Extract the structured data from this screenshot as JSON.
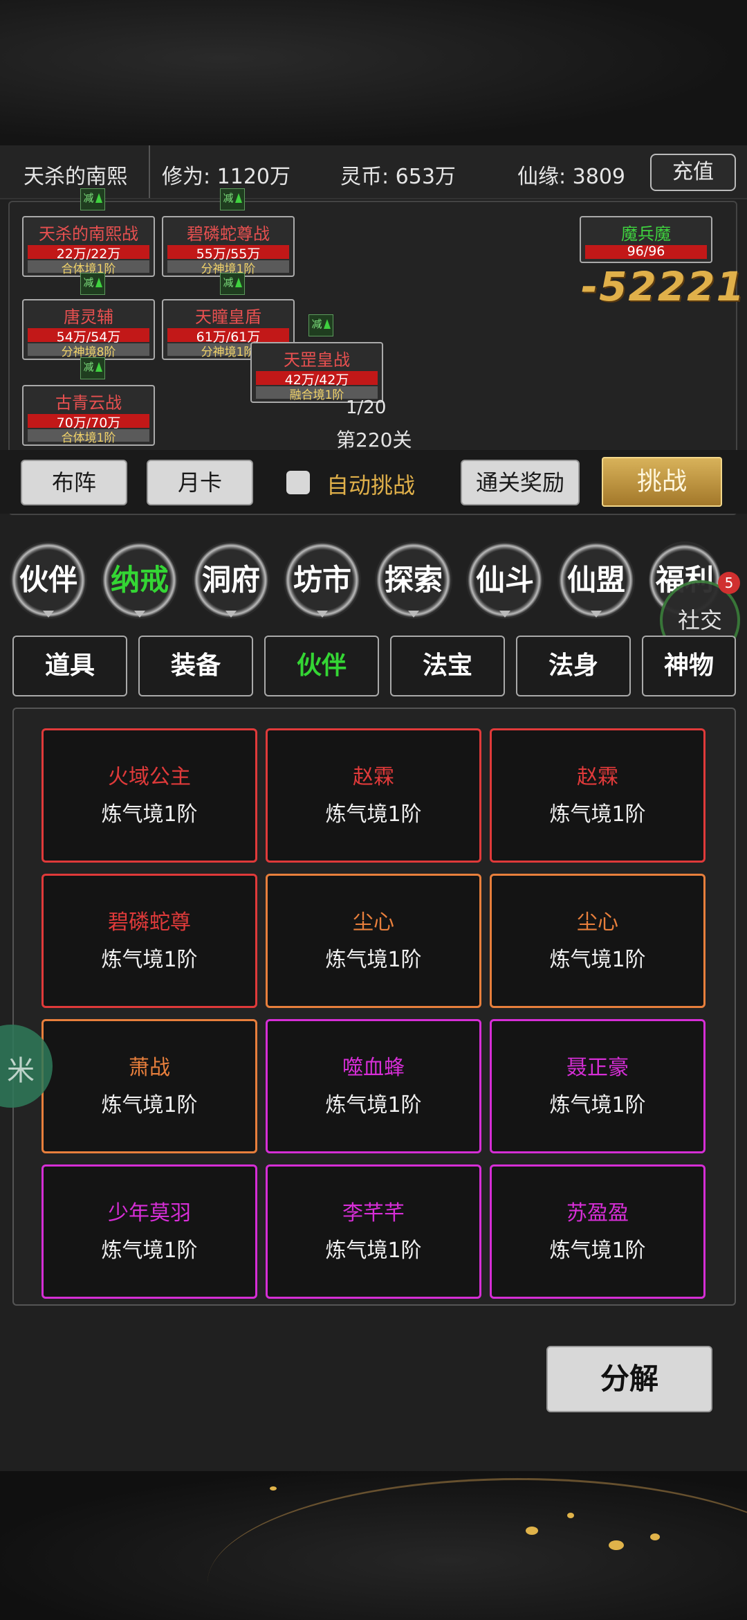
{
  "header": {
    "player_name": "天杀的南熙",
    "cultivation": "修为: 1120万",
    "spirit_coin": "灵币: 653万",
    "fate": "仙缘: 3809",
    "recharge_label": "充值"
  },
  "battle": {
    "reduce_label": "减",
    "allies": [
      {
        "name": "天杀的南熙战",
        "hp": "22万/22万",
        "realm": "合体境1阶"
      },
      {
        "name": "碧磷蛇尊战",
        "hp": "55万/55万",
        "realm": "分神境1阶"
      },
      {
        "name": "唐灵辅",
        "hp": "54万/54万",
        "realm": "分神境8阶"
      },
      {
        "name": "天瞳皇盾",
        "hp": "61万/61万",
        "realm": "分神境1阶"
      },
      {
        "name": "天罡皇战",
        "hp": "42万/42万",
        "realm": "融合境1阶"
      },
      {
        "name": "古青云战",
        "hp": "70万/70万",
        "realm": "合体境1阶"
      }
    ],
    "enemy": {
      "name": "魔兵魔",
      "hp": "96/96"
    },
    "damage": "-52221",
    "progress": "1/20",
    "stage": "第220关"
  },
  "controls": {
    "formation": "布阵",
    "monthly_card": "月卡",
    "auto_challenge": "自动挑战",
    "clear_reward": "通关奖励",
    "challenge": "挑战"
  },
  "nav": {
    "items": [
      "伙伴",
      "纳戒",
      "洞府",
      "坊市",
      "探索",
      "仙斗",
      "仙盟",
      "福利"
    ],
    "active": "纳戒",
    "social_label": "社交",
    "social_badge": "5"
  },
  "tabs": {
    "items": [
      "道具",
      "装备",
      "伙伴",
      "法宝",
      "法身",
      "神物"
    ],
    "active": "伙伴"
  },
  "inventory": [
    {
      "name": "火域公主",
      "level": "炼气境1阶",
      "color": "#e03a3a"
    },
    {
      "name": "赵霖",
      "level": "炼气境1阶",
      "color": "#e03a3a"
    },
    {
      "name": "赵霖",
      "level": "炼气境1阶",
      "color": "#e03a3a"
    },
    {
      "name": "碧磷蛇尊",
      "level": "炼气境1阶",
      "color": "#e03a3a"
    },
    {
      "name": "尘心",
      "level": "炼气境1阶",
      "color": "#e87f3c"
    },
    {
      "name": "尘心",
      "level": "炼气境1阶",
      "color": "#e87f3c"
    },
    {
      "name": "萧战",
      "level": "炼气境1阶",
      "color": "#e87f3c"
    },
    {
      "name": "噬血蜂",
      "level": "炼气境1阶",
      "color": "#d62ed6"
    },
    {
      "name": "聂正豪",
      "level": "炼气境1阶",
      "color": "#d62ed6"
    },
    {
      "name": "少年莫羽",
      "level": "炼气境1阶",
      "color": "#d62ed6"
    },
    {
      "name": "李芊芊",
      "level": "炼气境1阶",
      "color": "#d62ed6"
    },
    {
      "name": "苏盈盈",
      "level": "炼气境1阶",
      "color": "#d62ed6"
    }
  ],
  "decompose_label": "分解",
  "float_icon_glyph": "米"
}
